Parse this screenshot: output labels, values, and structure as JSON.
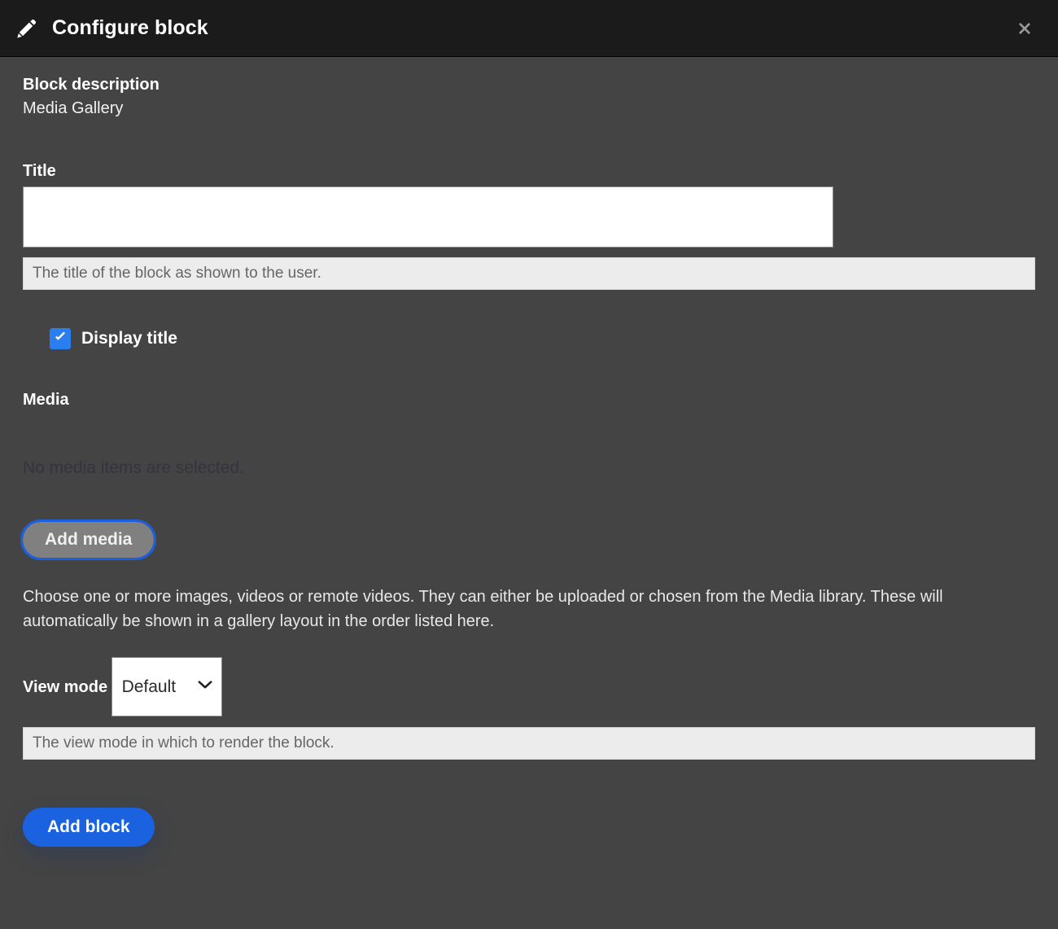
{
  "header": {
    "title": "Configure block",
    "pencil_icon": "pencil-icon",
    "close_icon": "close-icon",
    "background_color": "#1b1b1b"
  },
  "form": {
    "block_description": {
      "label": "Block description",
      "value": "Media Gallery"
    },
    "title_field": {
      "label": "Title",
      "value": "",
      "placeholder": "",
      "description": "The title of the block as shown to the user."
    },
    "display_title_checkbox": {
      "label": "Display title",
      "checked": true,
      "accent_color": "#2b7ef0"
    },
    "media": {
      "label": "Media",
      "empty_text": "No media items are selected.",
      "add_media_button": "Add media",
      "help_text": "Choose one or more images, videos or remote videos. They can either be uploaded or chosen from the Media library. These will automatically be shown in a gallery layout in the order listed here."
    },
    "view_mode": {
      "label": "View mode",
      "selected": "Default",
      "options": [
        "Default"
      ],
      "description": "The view mode in which to render the block.",
      "chevron_icon": "chevron-down-icon"
    },
    "submit_button": {
      "label": "Add block",
      "color": "#1a62e0"
    }
  }
}
